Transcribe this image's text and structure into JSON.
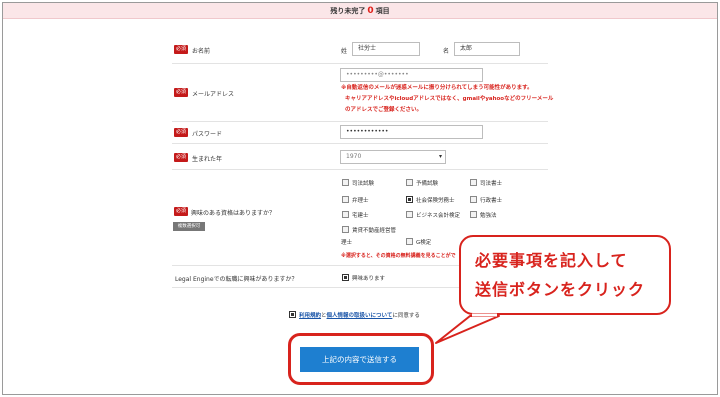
{
  "header": {
    "prefix": "残り未完了",
    "count": "0",
    "suffix": "項目"
  },
  "required_label": "必須",
  "name": {
    "label": "お名前",
    "last_label": "姓",
    "last_value": "社労士",
    "first_label": "名",
    "first_value": "太郎"
  },
  "email": {
    "label": "メールアドレス",
    "value": "•••••••••@•••••••",
    "note_1": "※自動返信のメールが迷惑メールに振り分けられてしまう可能性があります。",
    "note_2": "キャリアアドレスやicloudアドレスではなく、gmailやyahooなどのフリーメール",
    "note_3": "のアドレスでご登録ください。"
  },
  "password": {
    "label": "パスワード",
    "value": "••••••••••••"
  },
  "birth_year": {
    "label": "生まれた年",
    "value": "1970",
    "arrow": "▾"
  },
  "interests": {
    "label": "興味のある資格はありますか？",
    "multi_tag": "複数選択可",
    "options": [
      {
        "label": "司法試験",
        "checked": false
      },
      {
        "label": "予備試験",
        "checked": false
      },
      {
        "label": "司法書士",
        "checked": false
      },
      {
        "label": "弁理士",
        "checked": false
      },
      {
        "label": "社会保険労務士",
        "checked": true
      },
      {
        "label": "行政書士",
        "checked": false
      },
      {
        "label": "宅建士",
        "checked": false
      },
      {
        "label": "ビジネス会計検定",
        "checked": false
      },
      {
        "label": "勉強法",
        "checked": false
      },
      {
        "label": "賃貸不動産経営管",
        "checked": false
      },
      {
        "label": "G検定",
        "checked": false
      }
    ],
    "option_wrap": "理士",
    "note": "※選択すると、その資格の無料講義を見ることがで"
  },
  "transfer": {
    "label": "Legal Engineでの転職に興味がありますか？",
    "option": "興味あります",
    "checked": true
  },
  "agree": {
    "terms_link": "利用規約",
    "and": "と",
    "privacy_link": "個人情報の取扱いについて",
    "suffix": "に同意する",
    "checked": true
  },
  "submit": {
    "label": "上記の内容で送信する"
  },
  "callout": {
    "line_1": "必要事項を記入して",
    "line_2": "送信ボタンをクリック"
  },
  "colors": {
    "required": "#c41a1a",
    "callout": "#d8231d",
    "button": "#1e7fd0",
    "header_bg": "#fbe6e8"
  }
}
